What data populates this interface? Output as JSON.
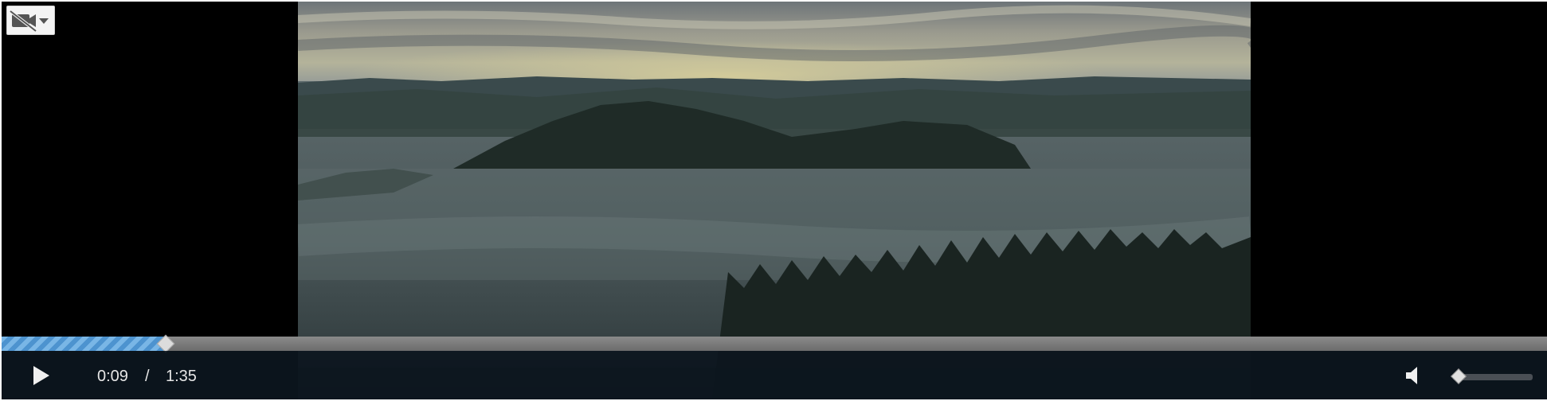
{
  "player": {
    "current_time": "0:09",
    "separator": "/",
    "duration": "1:35",
    "progress_fraction": 0.106,
    "volume_fraction": 0.06,
    "icons": {
      "camera": "video-camera-off-icon",
      "dropdown": "chevron-down-icon",
      "play": "play-icon",
      "volume": "speaker-icon"
    },
    "colors": {
      "progress_played": "#5ba3dc",
      "progress_track": "#7a7a7a",
      "control_bar": "#0c161e",
      "text": "#e6e6e6"
    }
  }
}
